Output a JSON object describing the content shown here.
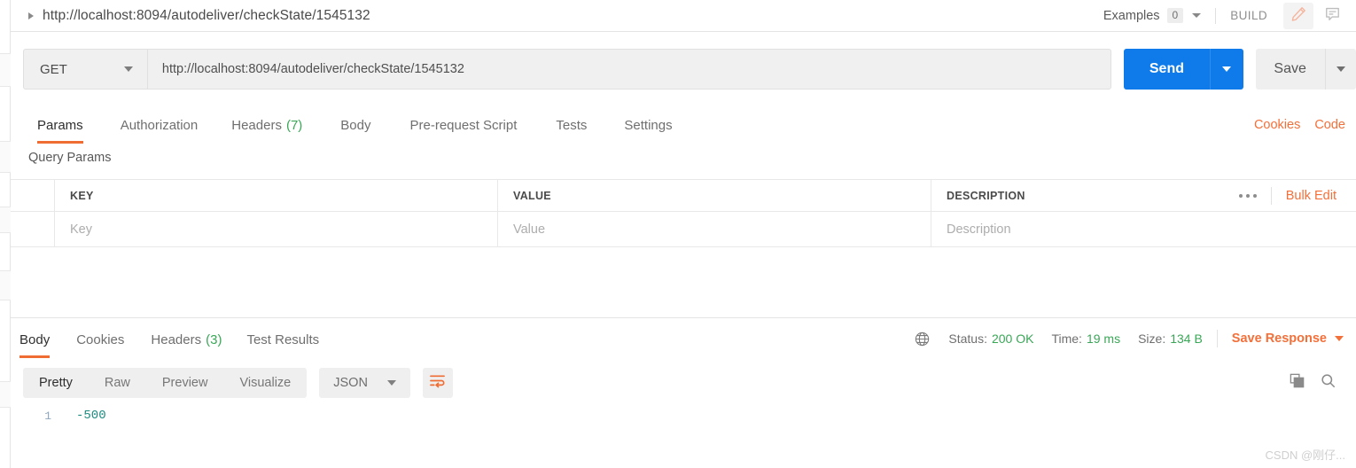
{
  "topbar": {
    "breadcrumb": "http://localhost:8094/autodeliver/checkState/1545132",
    "examples_label": "Examples",
    "examples_count": "0",
    "build_label": "BUILD",
    "edit_icon": "pencil-icon",
    "comment_icon": "comment-icon"
  },
  "request": {
    "method": "GET",
    "url": "http://localhost:8094/autodeliver/checkState/1545132",
    "send_label": "Send",
    "save_label": "Save"
  },
  "request_tabs": [
    {
      "label": "Params",
      "count": "",
      "active": true
    },
    {
      "label": "Authorization",
      "count": "",
      "active": false
    },
    {
      "label": "Headers",
      "count": "(7)",
      "active": false
    },
    {
      "label": "Body",
      "count": "",
      "active": false
    },
    {
      "label": "Pre-request Script",
      "count": "",
      "active": false
    },
    {
      "label": "Tests",
      "count": "",
      "active": false
    },
    {
      "label": "Settings",
      "count": "",
      "active": false
    }
  ],
  "request_tabs_right": {
    "cookies": "Cookies",
    "code": "Code"
  },
  "query_params": {
    "title": "Query Params",
    "columns": [
      "KEY",
      "VALUE",
      "DESCRIPTION"
    ],
    "bulk_edit": "Bulk Edit",
    "more_icon": "ellipsis-icon",
    "rows": [
      {
        "key": "",
        "value": "",
        "description": ""
      }
    ],
    "placeholders": {
      "key": "Key",
      "value": "Value",
      "description": "Description"
    }
  },
  "response_tabs": [
    {
      "label": "Body",
      "count": "",
      "active": true
    },
    {
      "label": "Cookies",
      "count": "",
      "active": false
    },
    {
      "label": "Headers",
      "count": "(3)",
      "active": false
    },
    {
      "label": "Test Results",
      "count": "",
      "active": false
    }
  ],
  "response_meta": {
    "globe_icon": "globe-icon",
    "status_label": "Status:",
    "status_value": "200 OK",
    "time_label": "Time:",
    "time_value": "19 ms",
    "size_label": "Size:",
    "size_value": "134 B",
    "save_response": "Save Response"
  },
  "response_toolbar": {
    "views": [
      {
        "label": "Pretty",
        "active": true
      },
      {
        "label": "Raw",
        "active": false
      },
      {
        "label": "Preview",
        "active": false
      },
      {
        "label": "Visualize",
        "active": false
      }
    ],
    "format": "JSON",
    "wrap_icon": "word-wrap-icon",
    "copy_icon": "copy-icon",
    "search_icon": "search-icon"
  },
  "response_body": {
    "lines": [
      {
        "number": "1",
        "text": "-500"
      }
    ]
  },
  "watermark": "CSDN @刚仔...",
  "colors": {
    "accent_orange": "#f3703a",
    "active_underline": "#ef6c33",
    "send_blue": "#0f7beb",
    "success_green": "#3aa757",
    "code_teal": "#1c8a7f"
  }
}
